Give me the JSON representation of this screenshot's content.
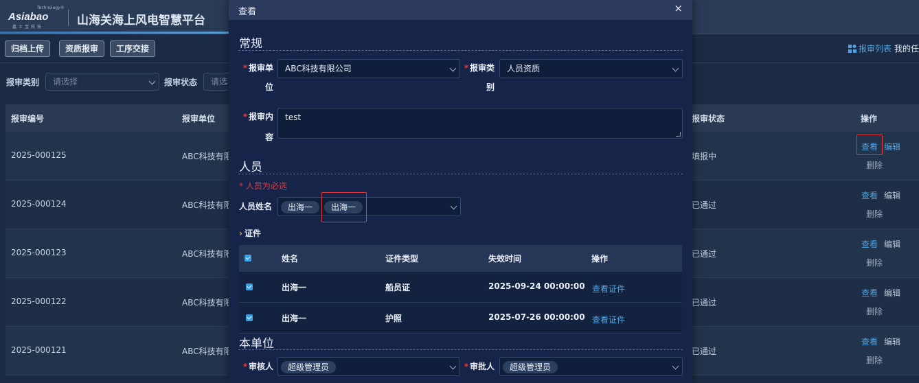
{
  "app": {
    "logo_text": "Asiabao",
    "logo_tech": "Technology®",
    "logo_sub": "嘉士宝科技",
    "title": "山海关海上风电智慧平台"
  },
  "toolbar": {
    "buttons": [
      "归档上传",
      "资质报审",
      "工序交接"
    ],
    "report_list": "报审列表",
    "my_tasks": "我的任"
  },
  "filters": {
    "category_label": "报审类别",
    "category_placeholder": "请选择",
    "status_label": "报审状态",
    "status_placeholder": "请选"
  },
  "grid": {
    "headers": [
      "报审编号",
      "报审单位",
      "报审状态",
      "操作"
    ],
    "rows": [
      {
        "id": "2025-000125",
        "unit": "ABC科技有限",
        "status": "填报中"
      },
      {
        "id": "2025-000124",
        "unit": "ABC科技有限",
        "status": "已通过"
      },
      {
        "id": "2025-000123",
        "unit": "ABC科技有限",
        "status": "已通过"
      },
      {
        "id": "2025-000122",
        "unit": "ABC科技有限",
        "status": "已通过"
      },
      {
        "id": "2025-000121",
        "unit": "ABC科技有限",
        "status": "已通过"
      }
    ],
    "actions": {
      "view": "查看",
      "edit": "编辑",
      "delete": "删除"
    }
  },
  "modal": {
    "title": "查看",
    "close": "×",
    "general": {
      "title": "常规",
      "unit_label_1": "报审单",
      "unit_label_2": "位",
      "unit_value": "ABC科技有限公司",
      "category_label_1": "报审类",
      "category_label_2": "别",
      "category_value": "人员资质",
      "content_label_1": "报审内",
      "content_label_2": "容",
      "content_value": "test"
    },
    "personnel": {
      "title": "人员",
      "required_msg": "* 人员为必选",
      "name_label": "人员姓名",
      "tags": [
        "出海一",
        "出海一"
      ],
      "cert_title": "证件",
      "cert_headers": [
        "姓名",
        "证件类型",
        "失效时间",
        "操作"
      ],
      "certs": [
        {
          "name": "出海一",
          "type": "船员证",
          "expiry": "2025-09-24 00:00:00",
          "action": "查看证件"
        },
        {
          "name": "出海一",
          "type": "护照",
          "expiry": "2025-07-26 00:00:00",
          "action": "查看证件"
        }
      ]
    },
    "unit": {
      "title": "本单位",
      "reviewer_label": "审核人",
      "reviewer_value": "超级管理员",
      "approver_label": "审批人",
      "approver_value": "超级管理员"
    }
  }
}
